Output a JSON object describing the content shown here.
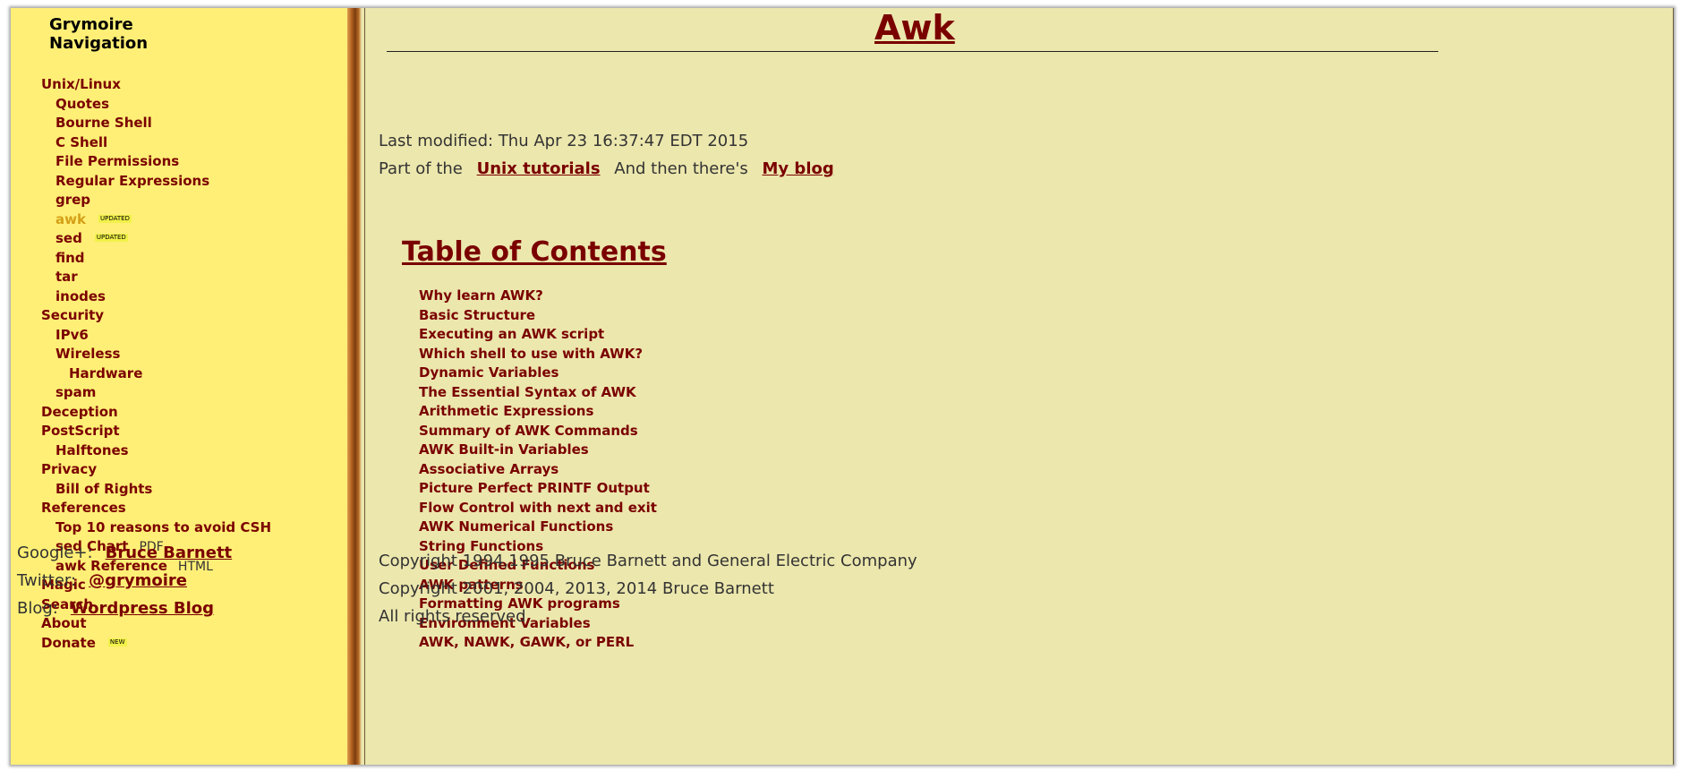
{
  "sidebar": {
    "title_line1": "Grymoire",
    "title_line2": "Navigation",
    "items": [
      {
        "label": "Unix/Linux",
        "level": 0
      },
      {
        "label": "Quotes",
        "level": 1
      },
      {
        "label": "Bourne Shell",
        "level": 1
      },
      {
        "label": "C Shell",
        "level": 1
      },
      {
        "label": "File Permissions",
        "level": 1
      },
      {
        "label": "Regular Expressions",
        "level": 1
      },
      {
        "label": "grep",
        "level": 1
      },
      {
        "label": "awk",
        "level": 1,
        "badge": "UPDATED",
        "current": true
      },
      {
        "label": "sed",
        "level": 1,
        "badge": "UPDATED"
      },
      {
        "label": "find",
        "level": 1
      },
      {
        "label": "tar",
        "level": 1
      },
      {
        "label": "inodes",
        "level": 1
      },
      {
        "label": "Security",
        "level": 0
      },
      {
        "label": "IPv6",
        "level": 1
      },
      {
        "label": "Wireless",
        "level": 1
      },
      {
        "label": "Hardware",
        "level": 2
      },
      {
        "label": "spam",
        "level": 1
      },
      {
        "label": "Deception",
        "level": 0
      },
      {
        "label": "PostScript",
        "level": 0
      },
      {
        "label": "Halftones",
        "level": 1
      },
      {
        "label": "Privacy",
        "level": 0
      },
      {
        "label": "Bill of Rights",
        "level": 1
      },
      {
        "label": "References",
        "level": 0
      },
      {
        "label": "Top 10 reasons to avoid CSH",
        "level": 1
      },
      {
        "label": "sed Chart",
        "level": 1,
        "suffix": "PDF"
      },
      {
        "label": "awk Reference",
        "level": 1,
        "suffix": "HTML"
      },
      {
        "label": "Magic",
        "level": 0
      },
      {
        "label": "Search",
        "level": 0
      },
      {
        "label": "About",
        "level": 0
      },
      {
        "label": "Donate",
        "level": 0,
        "badge": "NEW"
      }
    ],
    "social": {
      "google_label": "Google+:",
      "google_link": "Bruce Barnett",
      "twitter_label": "Twitter:",
      "twitter_link": "@grymoire",
      "blog_label": "Blog:",
      "blog_link": "Wordpress Blog"
    }
  },
  "main": {
    "title": "Awk",
    "last_modified": "Last modified: Thu Apr 23 16:37:47 EDT 2015",
    "part_of_prefix": "Part of the",
    "unix_tutorials_link": "Unix tutorials",
    "and_then": "And then there's",
    "blog_link": "My blog",
    "toc_heading": "Table of Contents",
    "toc": [
      "Why learn AWK?",
      "Basic Structure",
      "Executing an AWK script",
      "Which shell to use with AWK?",
      "Dynamic Variables",
      "The Essential Syntax of AWK",
      "Arithmetic Expressions",
      "Summary of AWK Commands",
      "AWK Built-in Variables",
      "Associative Arrays",
      "Picture Perfect PRINTF Output",
      "Flow Control with next and exit",
      "AWK Numerical Functions",
      "String Functions",
      "User Defined Functions",
      "AWK patterns",
      "Formatting AWK programs",
      "Environment Variables",
      "AWK, NAWK, GAWK, or PERL"
    ],
    "copyright1": "Copyright 1994,1995 Bruce Barnett and General Electric Company",
    "copyright2": "Copyright 2001, 2004, 2013, 2014 Bruce Barnett",
    "rights": "All rights reserved"
  },
  "colors": {
    "sidebar_bg": "#ffef76",
    "main_bg": "#ece7ad",
    "link": "#7a0000",
    "current": "#d4a017",
    "badge": "#f1f14a"
  }
}
